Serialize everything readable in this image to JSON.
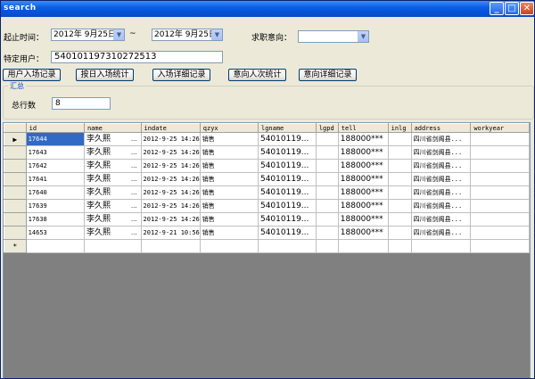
{
  "window": {
    "title": "search"
  },
  "titlebar_buttons": {
    "minimize": "_",
    "maximize": "□",
    "close": "✕"
  },
  "filters": {
    "start_time_label": "起止时间：",
    "start_date": "2012年 9月25日",
    "range_separator": "~",
    "end_date": "2012年 9月25日",
    "job_intent_label": "求职意向：",
    "job_intent_value": "",
    "user_label": "特定用户：",
    "user_value": "540101197310272513"
  },
  "buttons": {
    "user_entry": "用户入场记录",
    "daily_stats": "按日入场统计",
    "entry_detail": "入场详细记录",
    "intent_stats": "意向人次统计",
    "intent_detail": "意向详细记录"
  },
  "summary": {
    "group_title": "汇总",
    "total_label": "总行数",
    "total_value": "8"
  },
  "grid": {
    "columns": [
      "id",
      "name",
      "indate",
      "qzyx",
      "lgname",
      "lgpd",
      "tell",
      "inlg",
      "address",
      "workyear"
    ],
    "rows": [
      {
        "marker": "▶",
        "id": "17644",
        "name": "李久熙",
        "name_more": "...",
        "indate": "2012-9-25 14:26",
        "qzyx": "销售",
        "lgname": "54010119...",
        "lgpd": "",
        "tell": "188000***",
        "inlg": "",
        "address": "四川省剑阁县...",
        "workyear": ""
      },
      {
        "marker": "",
        "id": "17643",
        "name": "李久熙",
        "name_more": "...",
        "indate": "2012-9-25 14:26",
        "qzyx": "销售",
        "lgname": "54010119...",
        "lgpd": "",
        "tell": "188000***",
        "inlg": "",
        "address": "四川省剑阁县...",
        "workyear": ""
      },
      {
        "marker": "",
        "id": "17642",
        "name": "李久熙",
        "name_more": "...",
        "indate": "2012-9-25 14:26",
        "qzyx": "销售",
        "lgname": "54010119...",
        "lgpd": "",
        "tell": "188000***",
        "inlg": "",
        "address": "四川省剑阁县...",
        "workyear": ""
      },
      {
        "marker": "",
        "id": "17641",
        "name": "李久熙",
        "name_more": "...",
        "indate": "2012-9-25 14:26",
        "qzyx": "销售",
        "lgname": "54010119...",
        "lgpd": "",
        "tell": "188000***",
        "inlg": "",
        "address": "四川省剑阁县...",
        "workyear": ""
      },
      {
        "marker": "",
        "id": "17640",
        "name": "李久熙",
        "name_more": "...",
        "indate": "2012-9-25 14:26",
        "qzyx": "销售",
        "lgname": "54010119...",
        "lgpd": "",
        "tell": "188000***",
        "inlg": "",
        "address": "四川省剑阁县...",
        "workyear": ""
      },
      {
        "marker": "",
        "id": "17639",
        "name": "李久熙",
        "name_more": "...",
        "indate": "2012-9-25 14:26",
        "qzyx": "销售",
        "lgname": "54010119...",
        "lgpd": "",
        "tell": "188000***",
        "inlg": "",
        "address": "四川省剑阁县...",
        "workyear": ""
      },
      {
        "marker": "",
        "id": "17638",
        "name": "李久熙",
        "name_more": "...",
        "indate": "2012-9-25 14:26",
        "qzyx": "销售",
        "lgname": "54010119...",
        "lgpd": "",
        "tell": "188000***",
        "inlg": "",
        "address": "四川省剑阁县...",
        "workyear": ""
      },
      {
        "marker": "",
        "id": "14653",
        "name": "李久熙",
        "name_more": "...",
        "indate": "2012-9-21 10:56",
        "qzyx": "销售",
        "lgname": "54010119...",
        "lgpd": "",
        "tell": "188000***",
        "inlg": "",
        "address": "四川省剑阁县...",
        "workyear": ""
      }
    ],
    "new_row_marker": "*"
  },
  "colors": {
    "title_bar": "#0553d6",
    "selection": "#316ac5",
    "grid_background": "#808080",
    "group_title": "#0046d5"
  }
}
